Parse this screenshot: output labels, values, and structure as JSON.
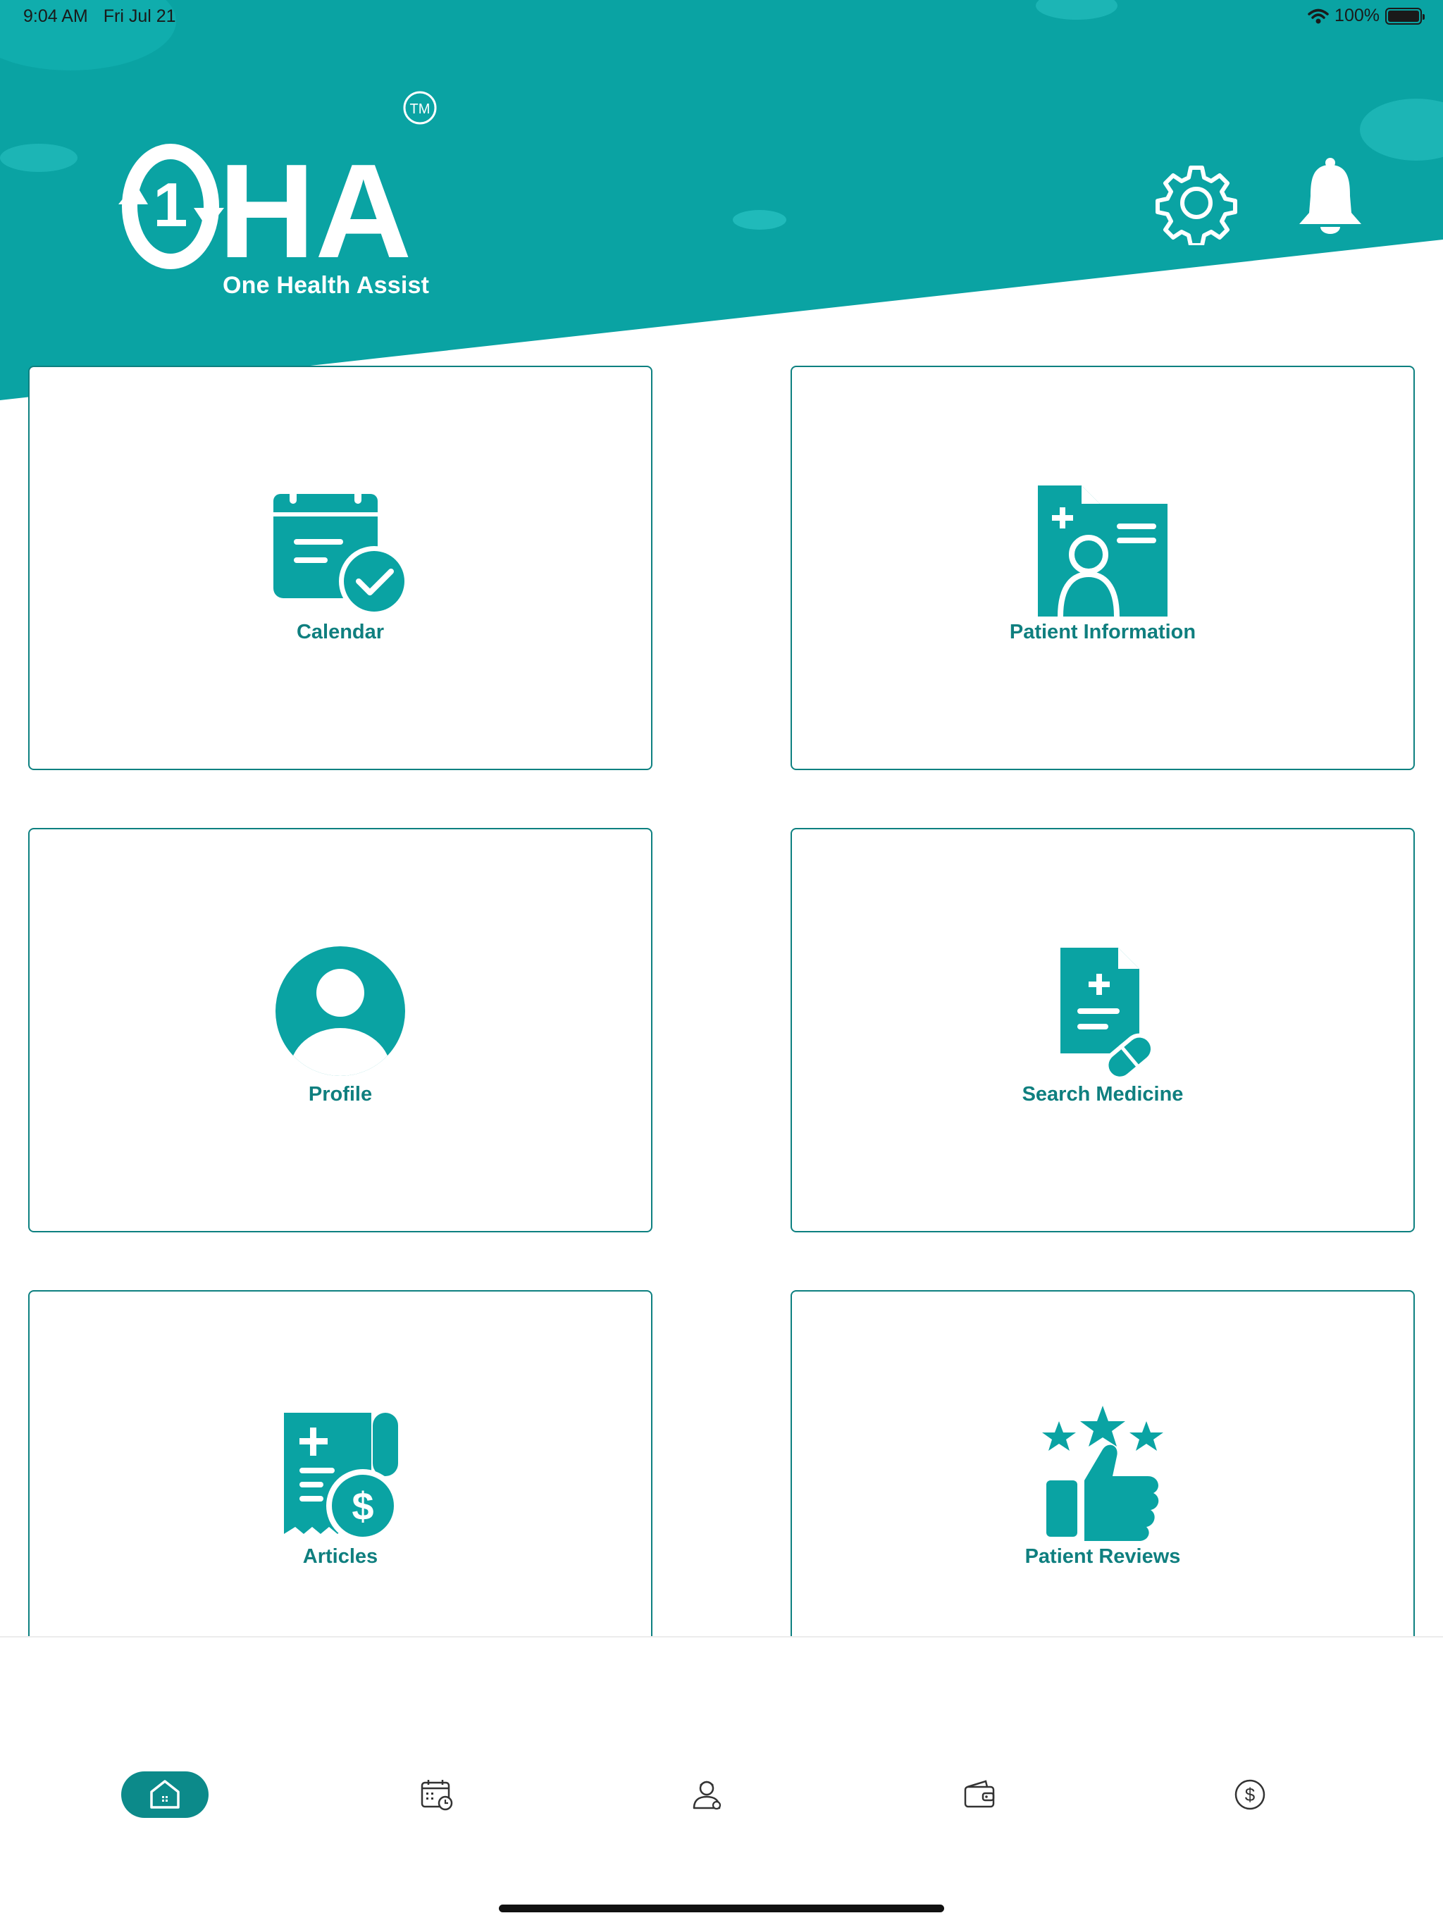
{
  "status_bar": {
    "time": "9:04 AM",
    "date": "Fri Jul 21",
    "battery": "100%"
  },
  "header": {
    "logo": {
      "mark": "1",
      "text": "HA",
      "trademark": "TM"
    },
    "tagline": "One Health Assist"
  },
  "tiles": [
    {
      "label": "Calendar"
    },
    {
      "label": "Patient Information"
    },
    {
      "label": "Profile"
    },
    {
      "label": "Search Medicine"
    },
    {
      "label": "Articles"
    },
    {
      "label": "Patient Reviews"
    }
  ],
  "colors": {
    "teal": "#0aa3a3",
    "teal_dark": "#0c8a8a",
    "label": "#0f7f7f"
  }
}
